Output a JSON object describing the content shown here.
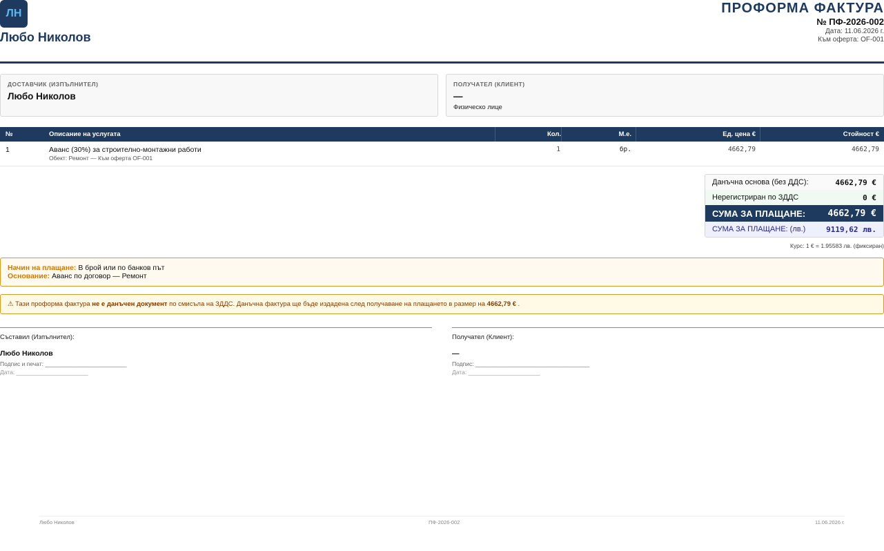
{
  "header": {
    "logo_text": "ЛН",
    "company_name": "Любо Николов",
    "title": "ПРОФОРМА ФАКТУРА",
    "number": "№ ПФ-2026-002",
    "date": "Дата: 11.06.2026 г.",
    "offer_ref": "Към оферта: OF-001"
  },
  "supplier": {
    "label": "ДОСТАВЧИК (ИЗПЪЛНИТЕЛ)",
    "name": "Любо Николов"
  },
  "recipient": {
    "label": "ПОЛУЧАТЕЛ (КЛИЕНТ)",
    "name": "—",
    "type": "Физическо лице"
  },
  "table": {
    "headers": [
      "№",
      "Описание на услугата",
      "Кол.",
      "М.е.",
      "Ед. цена €",
      "Стойност €"
    ],
    "rows": [
      {
        "num": "1",
        "description": "Аванс (30%) за строително-монтажни работи",
        "subtitle": "Обект: Ремонт — Към оферта OF-001",
        "qty": "1",
        "unit": "бр.",
        "unit_price": "4662,79",
        "amount": "4662,79"
      }
    ]
  },
  "totals": {
    "base_label": "Данъчна основа (без ДДС):",
    "base_value": "4662,79 €",
    "novat_label": "Нерегистриран по ЗДДС",
    "novat_value": "0 €",
    "total_label": "СУМА ЗА ПЛАЩАНЕ:",
    "total_value": "4662,79 €",
    "total_bgn_label": "СУМА ЗА ПЛАЩАНЕ: (лв.)",
    "total_bgn_value": "9119,62 лв.",
    "rate_note": "Курс: 1 € = 1.95583 лв. (фиксиран)"
  },
  "payment": {
    "method_label": "Начин на плащане:",
    "method_value": " В брой или по банков път",
    "basis_label": "Основание:",
    "basis_value": " Аванс по договор — Ремонт"
  },
  "note": {
    "icon": "⚠",
    "part1": " Тази проформа фактура ",
    "bold1": "не е данъчен документ",
    "part2": " по смисъла на ЗДДС. Данъчна фактура ще бъде издадена след получаване на плащането в размер на ",
    "bold2": "4662,79 €",
    "part3": " ."
  },
  "signatures": {
    "left_label": "Съставил (Изпълнител):",
    "left_name": "Любо Николов",
    "left_sign": "Подпис и печат: _________________________",
    "left_date": "Дата: ______________________",
    "right_label": "Получател (Клиент):",
    "right_name": "—",
    "right_sign": "Подпис: ___________________________________",
    "right_date": "Дата: ______________________"
  },
  "footer": {
    "left": "Любо Николов",
    "center": "ПФ-2026-002",
    "right": "11.06.2026 г."
  },
  "colors": {
    "primary": "#1e3a5f",
    "accent": "#d07a00",
    "warning_text": "#8a3a00"
  }
}
